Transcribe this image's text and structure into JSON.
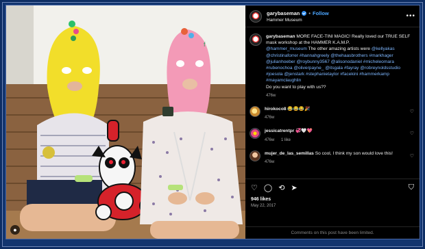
{
  "post": {
    "author": "garybaseman",
    "follow_label": "Follow",
    "location": "Hammer Museum",
    "more_label": "•••"
  },
  "caption": {
    "author": "garybaseman",
    "text_1": "MORE FACE-TINI MAGIC! Really loved our TRUE SELF mask workshop at the HAMMER K.A.M.P.",
    "text_2": "@hammer_museum",
    "text_3": " The other amazing artists were ",
    "tags": "@kellyakas @christinaforrer #hannahgreely @thehaasbrothers #markhager @julianhoeber @roybunny3567 @alisonodaniel #micheleomara #rubenochoa @oliverpayne_ @itsgala #fayray @robreynoldsstudio #joesola @jenstark #stephanietaylor #facekini #hammerkamp #mayamclaughlin",
    "text_4": "Do you want to play with us??",
    "time": "476w"
  },
  "comments": [
    {
      "user": "hirokoco8",
      "text": "😂😂😂🎉",
      "time": "476w",
      "likes": ""
    },
    {
      "user": "jessicatrentpr",
      "text": "💞🤍💖",
      "time": "476w",
      "likes": "1 like"
    },
    {
      "user": "mujer_de_las_semillas",
      "text": "So cool, I think my son would love this!",
      "time": "476w",
      "likes": ""
    }
  ],
  "actions": {
    "likes": "946 likes",
    "date": "May 22, 2017",
    "comments_limited": "Comments on this post have been limited."
  },
  "icons": [
    "heart-icon",
    "comment-icon",
    "repost-icon",
    "share-icon",
    "bookmark-icon"
  ]
}
